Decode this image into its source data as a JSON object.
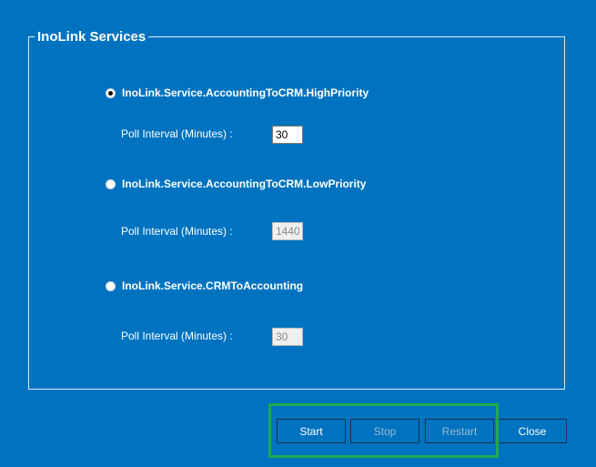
{
  "group": {
    "title": "InoLink Services"
  },
  "services": [
    {
      "name": "InoLink.Service.AccountingToCRM.HighPriority",
      "selected": true,
      "poll_label": "Poll Interval (Minutes) :",
      "poll_value": "30",
      "poll_enabled": true
    },
    {
      "name": "InoLink.Service.AccountingToCRM.LowPriority",
      "selected": false,
      "poll_label": "Poll Interval (Minutes) :",
      "poll_value": "1440",
      "poll_enabled": false
    },
    {
      "name": "InoLink.Service.CRMToAccounting",
      "selected": false,
      "poll_label": "Poll Interval (Minutes) :",
      "poll_value": "30",
      "poll_enabled": false
    }
  ],
  "buttons": {
    "start": "Start",
    "stop": "Stop",
    "restart": "Restart",
    "close": "Close"
  },
  "colors": {
    "background": "#0073C0",
    "highlight": "#21a84a"
  }
}
